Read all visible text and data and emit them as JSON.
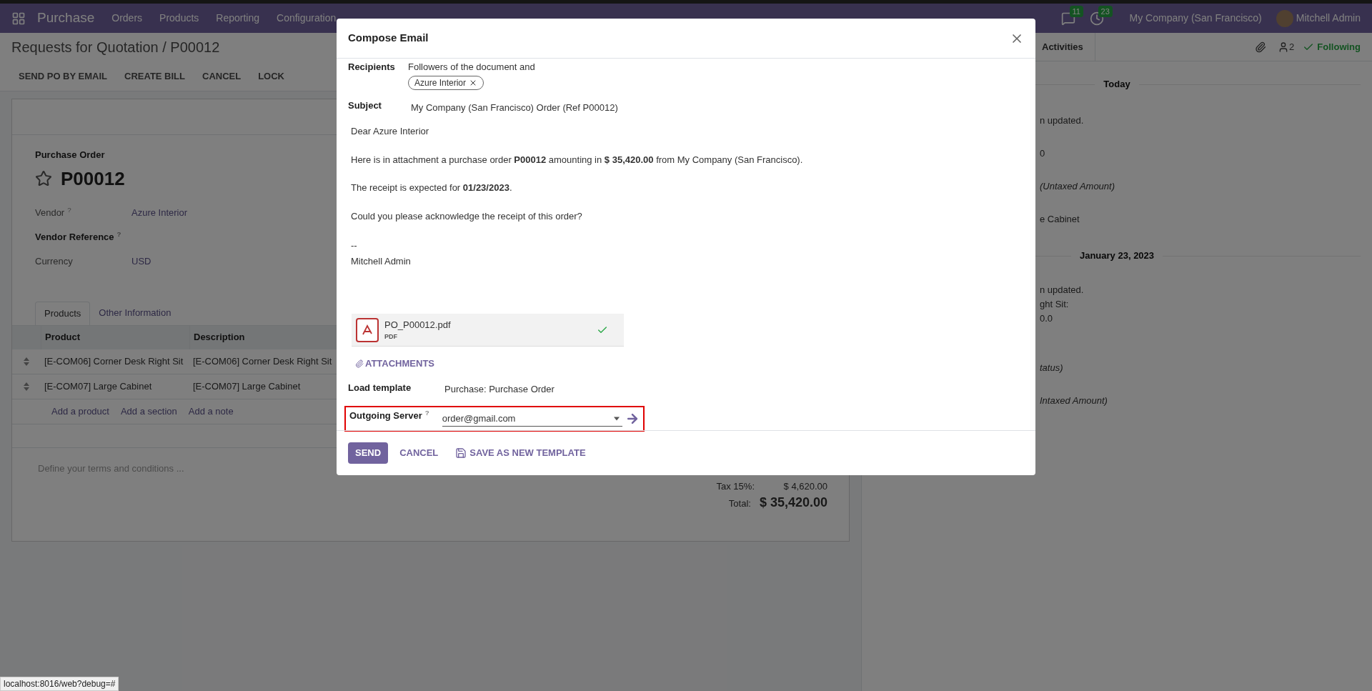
{
  "navbar": {
    "app": "Purchase",
    "menu": [
      "Orders",
      "Products",
      "Reporting",
      "Configuration"
    ],
    "messages_count": "11",
    "activities_count": "23",
    "company": "My Company (San Francisco)",
    "user": "Mitchell Admin"
  },
  "breadcrumb": "Requests for Quotation / P00012",
  "actions": [
    "SEND PO BY EMAIL",
    "CREATE BILL",
    "CANCEL",
    "LOCK"
  ],
  "form": {
    "type_label": "Purchase Order",
    "name": "P00012",
    "starred": false,
    "fields": [
      {
        "label": "Vendor",
        "help": "?",
        "value": "Azure Interior",
        "emphasized": false
      },
      {
        "label": "Vendor Reference",
        "help": "?",
        "emphasized": true
      },
      {
        "label": "Currency",
        "value": "USD",
        "emphasized": false
      }
    ],
    "tabs": [
      {
        "label": "Products",
        "selected": true
      },
      {
        "label": "Other Information",
        "selected": false
      }
    ],
    "table": {
      "columns": [
        "Product",
        "Description"
      ],
      "rows": [
        [
          "[E-COM06] Corner Desk Right Sit",
          "[E-COM06] Corner Desk Right Sit"
        ],
        [
          "[E-COM07] Large Cabinet",
          "[E-COM07] Large Cabinet"
        ]
      ]
    },
    "add_links": [
      "Add a product",
      "Add a section",
      "Add a note"
    ],
    "terms_placeholder": "Define your terms and conditions ...",
    "totals": [
      {
        "label": "Tax 15%:",
        "value": "$ 4,620.00",
        "kind": "line"
      },
      {
        "label": "Total:",
        "value": "$ 35,420.00",
        "kind": "grand"
      }
    ]
  },
  "chatter": {
    "activities": "Activities",
    "followers_count": "2",
    "following": "Following",
    "entries": [
      {
        "kind": "date",
        "text": "Today"
      },
      {
        "kind": "line",
        "text": "n updated.",
        "italic": false
      },
      {
        "kind": "line",
        "text": "0",
        "italic": false
      },
      {
        "kind": "line",
        "text": "(Untaxed Amount)",
        "italic": true
      },
      {
        "kind": "line",
        "text": "e Cabinet",
        "italic": false
      },
      {
        "kind": "date",
        "text": "January 23, 2023"
      },
      {
        "kind": "tight",
        "text": "n updated.",
        "italic": false
      },
      {
        "kind": "tight",
        "text": "ght Sit:",
        "italic": false
      },
      {
        "kind": "tight",
        "text": "0.0",
        "italic": false
      },
      {
        "kind": "line",
        "text": "tatus)",
        "italic": true
      },
      {
        "kind": "line",
        "text": "Intaxed Amount)",
        "italic": true
      }
    ]
  },
  "dialog": {
    "title": "Compose Email",
    "recipients_label": "Recipients",
    "recipients_text": "Followers of the document and",
    "recipient_tags": [
      "Azure Interior"
    ],
    "subject_label": "Subject",
    "subject": "My Company (San Francisco) Order (Ref P00012)",
    "body": [
      "Dear Azure Interior",
      "Here is in attachment a purchase order **P00012** amounting in **$ 35,420.00** from My Company (San Francisco).",
      "The receipt is expected for **01/23/2023**.",
      "Could you please acknowledge the receipt of this order?"
    ],
    "signature": [
      "--",
      "Mitchell Admin"
    ],
    "attachment": {
      "name": "PO_P00012.pdf",
      "type": "PDF",
      "uploaded": true
    },
    "attachments_button": "ATTACHMENTS",
    "template_label": "Load template",
    "template": "Purchase: Purchase Order",
    "server_label": "Outgoing Server",
    "server_help": "?",
    "server": "order@gmail.com",
    "server_highlighted": true,
    "buttons": [
      {
        "label": "SEND",
        "kind": "primary"
      },
      {
        "label": "CANCEL",
        "kind": "link"
      },
      {
        "label": "SAVE AS NEW TEMPLATE",
        "kind": "save"
      }
    ]
  },
  "status_url": "localhost:8016/web?debug=#"
}
